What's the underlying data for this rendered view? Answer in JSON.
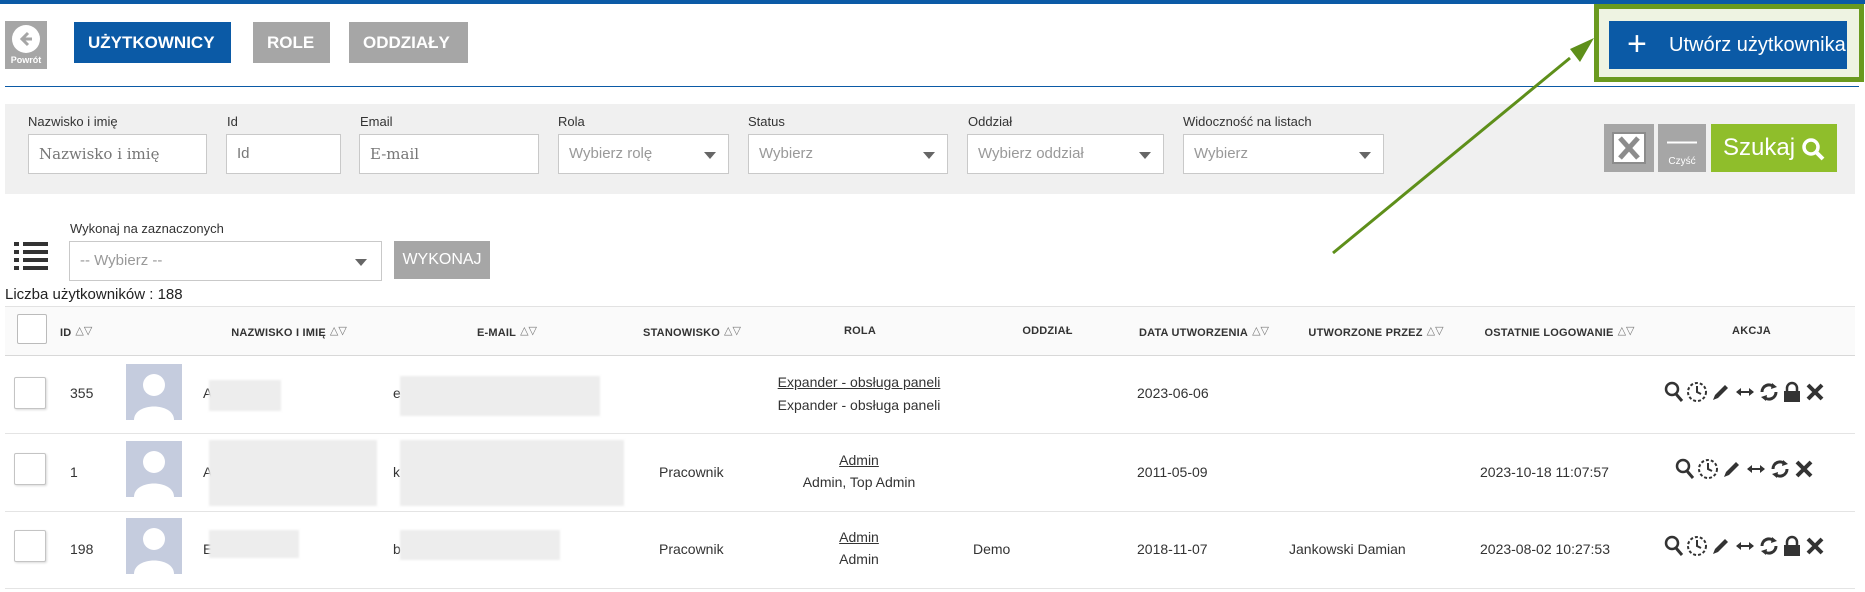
{
  "nav": {
    "back_label": "Powrót",
    "tabs": [
      {
        "label": "UŻYTKOWNICY",
        "active": true
      },
      {
        "label": "ROLE",
        "active": false
      },
      {
        "label": "ODDZIAŁY",
        "active": false
      }
    ],
    "create_button": "Utwórz użytkownika"
  },
  "filters": {
    "name": {
      "label": "Nazwisko i imię",
      "placeholder": "Nazwisko i imię"
    },
    "id": {
      "label": "Id",
      "placeholder": "Id"
    },
    "email": {
      "label": "Email",
      "placeholder": "E-mail"
    },
    "role": {
      "label": "Rola",
      "placeholder": "Wybierz rolę"
    },
    "status": {
      "label": "Status",
      "placeholder": "Wybierz"
    },
    "branch": {
      "label": "Oddział",
      "placeholder": "Wybierz oddział"
    },
    "visibility": {
      "label": "Widoczność na listach",
      "placeholder": "Wybierz"
    },
    "clear_label": "Czyść",
    "search_label": "Szukaj"
  },
  "bulk": {
    "label": "Wykonaj na zaznaczonych",
    "placeholder": "-- Wybierz --",
    "execute_label": "WYKONAJ"
  },
  "count_text": "Liczba użytkowników : 188",
  "table": {
    "columns": {
      "id": "ID",
      "name": "NAZWISKO I IMIĘ",
      "email": "E-MAIL",
      "position": "STANOWISKO",
      "role": "ROLA",
      "branch": "ODDZIAŁ",
      "created": "DATA UTWORZENIA",
      "created_by": "UTWORZONE PRZEZ",
      "last_login": "OSTATNIE LOGOWANIE",
      "action": "AKCJA"
    },
    "rows": [
      {
        "id": "355",
        "name": "A",
        "email": "e",
        "position": "",
        "role_main": "Expander - obsługa paneli",
        "role_sub": "Expander - obsługa paneli",
        "branch": "",
        "created": "2023-06-06",
        "created_by": "",
        "last_login": "",
        "locked_icon": true
      },
      {
        "id": "1",
        "name": "A",
        "email": "k",
        "position": "Pracownik",
        "role_main": "Admin",
        "role_sub": "Admin, Top Admin",
        "branch": "",
        "created": "2011-05-09",
        "created_by": "",
        "last_login": "2023-10-18 11:07:57",
        "locked_icon": false
      },
      {
        "id": "198",
        "name": "E",
        "email": "b",
        "position": "Pracownik",
        "role_main": "Admin",
        "role_sub": "Admin",
        "branch": "Demo",
        "created": "2018-11-07",
        "created_by": "Jankowski Damian",
        "last_login": "2023-08-02 10:27:53",
        "locked_icon": true
      }
    ]
  },
  "colors": {
    "primary": "#0b5aa6",
    "grey_button": "#a6a6a6",
    "search_green": "#8fbe2b",
    "highlight_border": "#6a9a1f"
  }
}
